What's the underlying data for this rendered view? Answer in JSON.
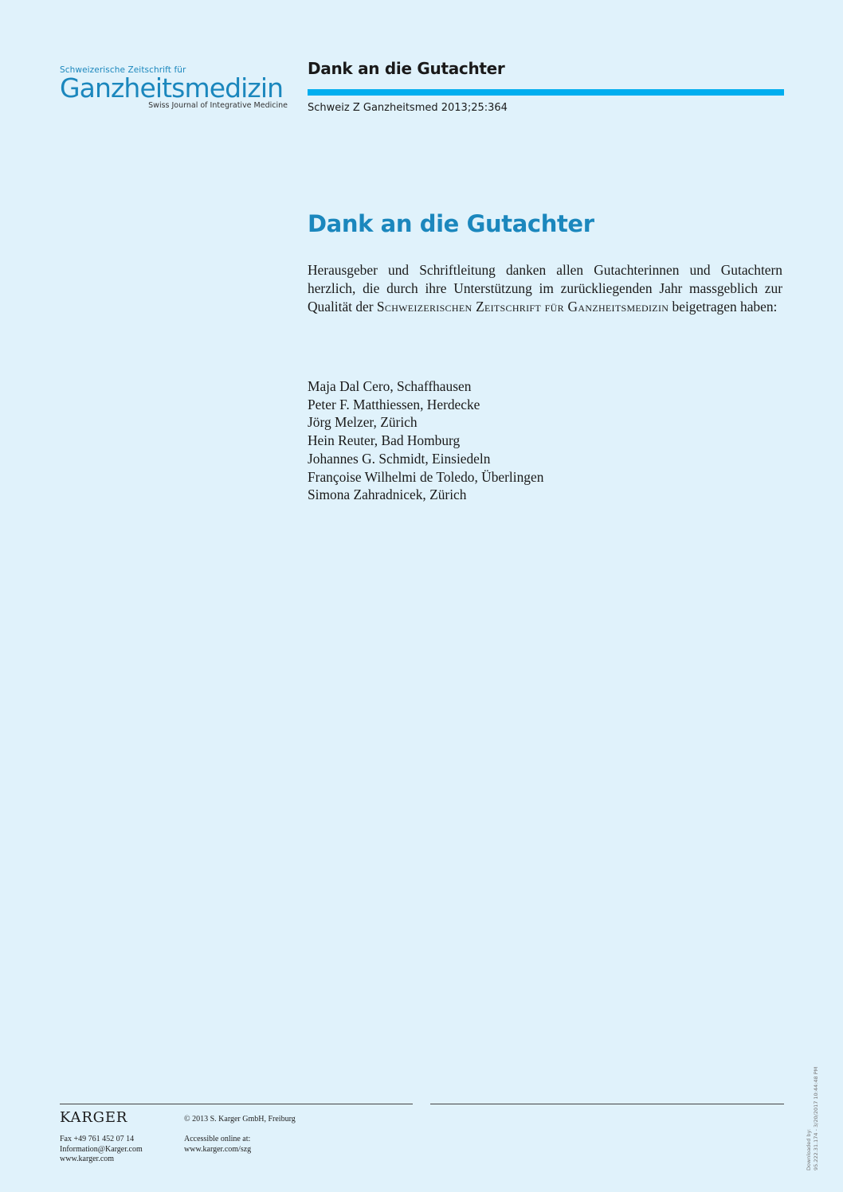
{
  "journal_logo": {
    "superscript": "Schweizerische Zeitschrift für",
    "main": "Ganzheitsmedizin",
    "subtitle": "Swiss Journal of Integrative Medicine"
  },
  "header": {
    "title": "Dank an die Gutachter",
    "citation": "Schweiz Z Ganzheitsmed 2013;25:364",
    "accent_color": "#00aeef"
  },
  "article": {
    "title": "Dank an die Gutachter",
    "intro_before": "Herausgeber und Schriftleitung danken allen Gutachterinnen und Gutachtern herzlich, die durch ihre Unterstützung im zurückliegenden Jahr massgeblich zur Qualität der ",
    "intro_journal": "Schweizerischen Zeitschrift für Ganzheitsmedizin",
    "intro_after": " beigetragen haben:",
    "reviewers": [
      "Maja Dal Cero, Schaffhausen",
      "Peter F. Matthiessen, Herdecke",
      "Jörg Melzer, Zürich",
      "Hein Reuter, Bad Homburg",
      "Johannes G. Schmidt, Einsiedeln",
      "Françoise Wilhelmi de Toledo, Überlingen",
      "Simona Zahradnicek, Zürich"
    ]
  },
  "footer": {
    "publisher_logo": "KARGER",
    "fax": "Fax +49 761 452 07 14",
    "email": "Information@Karger.com",
    "website": "www.karger.com",
    "copyright": "© 2013 S. Karger GmbH, Freiburg",
    "accessible_label": "Accessible online at:",
    "accessible_url": "www.karger.com/szg"
  },
  "download_stamp": {
    "line1": "Downloaded by:",
    "line2": "95.222.31.174 - 3/20/2017 10:44:48 PM"
  },
  "colors": {
    "background": "#e0f2fb",
    "brand_blue": "#1b87bd"
  }
}
